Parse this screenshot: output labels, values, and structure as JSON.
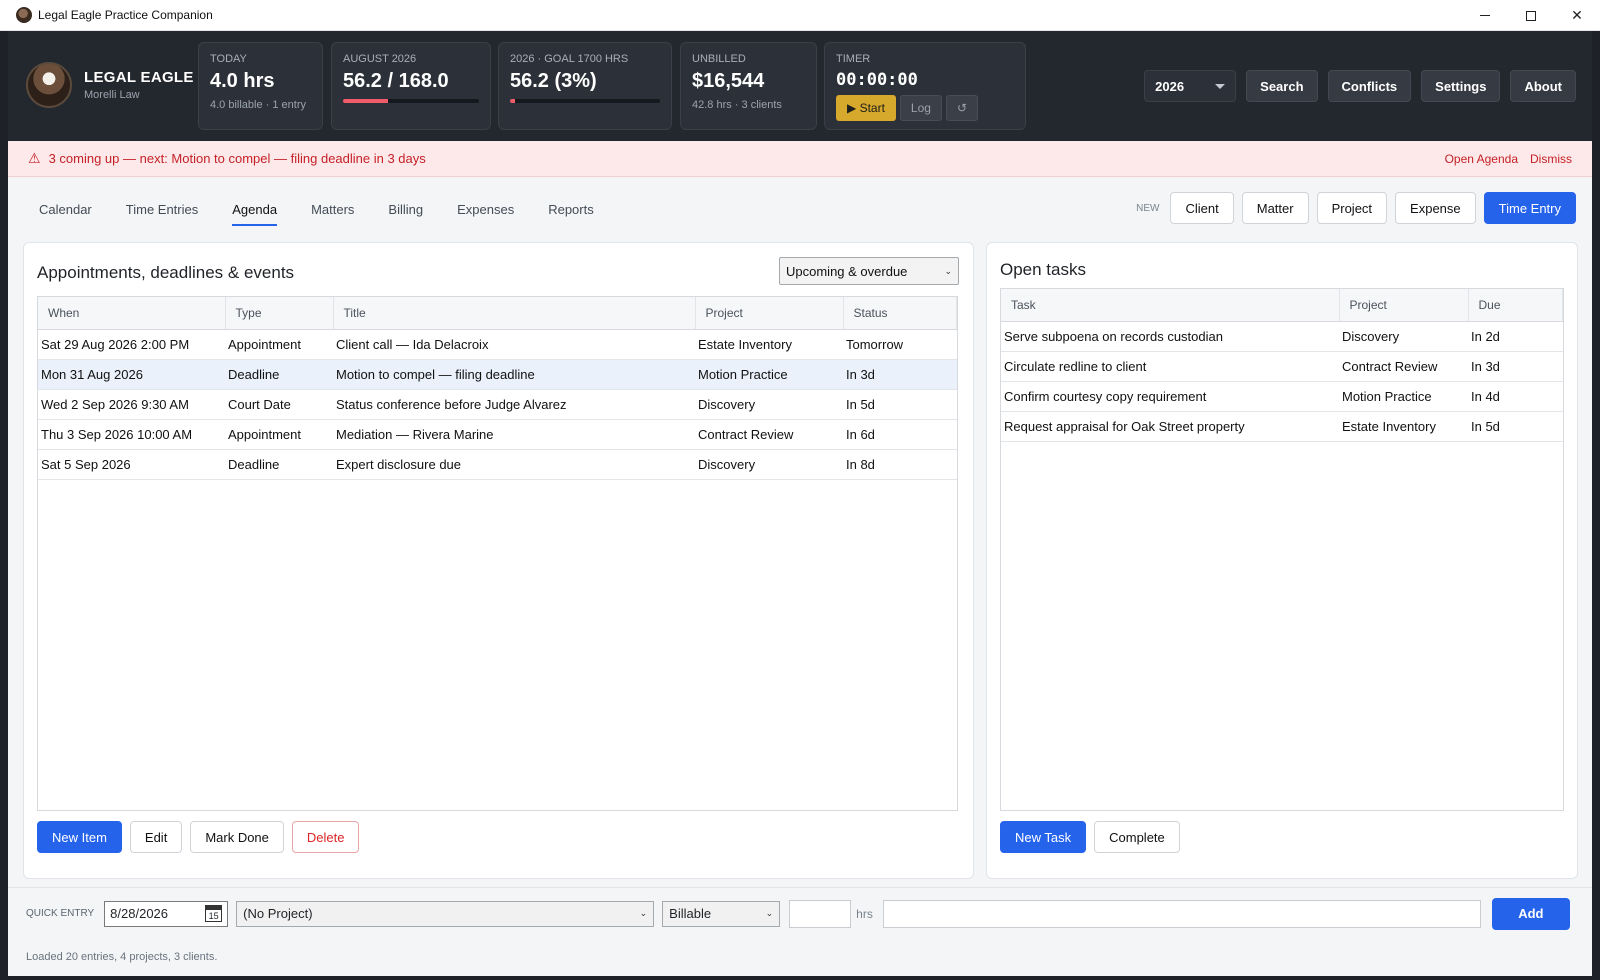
{
  "window": {
    "title": "Legal Eagle Practice Companion",
    "controls": {
      "min": "",
      "max": "",
      "close": "✕"
    }
  },
  "brand": {
    "name": "LEGAL EAGLE",
    "firm": "Morelli Law"
  },
  "stats": {
    "today": {
      "label": "TODAY",
      "value": "4.0 hrs",
      "sub": "4.0 billable · 1 entry"
    },
    "month": {
      "label": "AUGUST 2026",
      "value": "56.2 / 168.0",
      "progress": 0.33
    },
    "goal": {
      "label": "2026  ·  GOAL 1700 HRS",
      "value": "56.2  (3%)",
      "progress": 0.03
    },
    "unbilled": {
      "label": "UNBILLED",
      "value": "$16,544",
      "sub": "42.8 hrs · 3 clients"
    },
    "timer": {
      "label": "TIMER",
      "value": "00:00:00",
      "start": "▶ Start",
      "log": "Log",
      "reset": "↺"
    }
  },
  "header_right": {
    "year": "2026",
    "search": "Search",
    "conflicts": "Conflicts",
    "settings": "Settings",
    "about": "About"
  },
  "alert": {
    "icon": "⚠",
    "text": "3 coming up — next: Motion to compel — filing deadline in 3 days",
    "open_agenda": "Open Agenda",
    "dismiss": "Dismiss"
  },
  "tabs": [
    {
      "label": "Calendar"
    },
    {
      "label": "Time Entries"
    },
    {
      "label": "Agenda",
      "active": true
    },
    {
      "label": "Matters"
    },
    {
      "label": "Billing"
    },
    {
      "label": "Expenses"
    },
    {
      "label": "Reports"
    }
  ],
  "new_row": {
    "label": "NEW",
    "client": "Client",
    "matter": "Matter",
    "project": "Project",
    "expense": "Expense",
    "time_entry": "Time Entry"
  },
  "agenda": {
    "title": "Appointments, deadlines & events",
    "filter": "Upcoming & overdue",
    "columns": [
      "When",
      "Type",
      "Title",
      "Project",
      "Status"
    ],
    "rows": [
      [
        "Sat 29 Aug 2026  2:00 PM",
        "Appointment",
        "Client call — Ida Delacroix",
        "Estate Inventory",
        "Tomorrow"
      ],
      [
        "Mon 31 Aug 2026",
        "Deadline",
        "Motion to compel — filing deadline",
        "Motion Practice",
        "In 3d"
      ],
      [
        "Wed 2 Sep 2026  9:30 AM",
        "Court Date",
        "Status conference before Judge Alvarez",
        "Discovery",
        "In 5d"
      ],
      [
        "Thu 3 Sep 2026  10:00 AM",
        "Appointment",
        "Mediation — Rivera Marine",
        "Contract Review",
        "In 6d"
      ],
      [
        "Sat 5 Sep 2026",
        "Deadline",
        "Expert disclosure due",
        "Discovery",
        "In 8d"
      ]
    ],
    "buttons": {
      "new_item": "New Item",
      "edit": "Edit",
      "mark_done": "Mark Done",
      "delete": "Delete"
    }
  },
  "tasks": {
    "title": "Open tasks",
    "columns": [
      "Task",
      "Project",
      "Due"
    ],
    "rows": [
      [
        "Serve subpoena on records custodian",
        "Discovery",
        "In 2d"
      ],
      [
        "Circulate redline to client",
        "Contract Review",
        "In 3d"
      ],
      [
        "Confirm courtesy copy requirement",
        "Motion Practice",
        "In 4d"
      ],
      [
        "Request appraisal for Oak Street property",
        "Estate Inventory",
        "In 5d"
      ]
    ],
    "buttons": {
      "new_task": "New Task",
      "complete": "Complete"
    }
  },
  "quick_entry": {
    "label": "QUICK ENTRY",
    "date": "8/28/2026",
    "calendar_day": "15",
    "project": "(No Project)",
    "billing": "Billable",
    "hours": "",
    "hours_unit": "hrs",
    "description": "",
    "add": "Add"
  },
  "status": "Loaded 20 entries, 4 projects, 3 clients."
}
